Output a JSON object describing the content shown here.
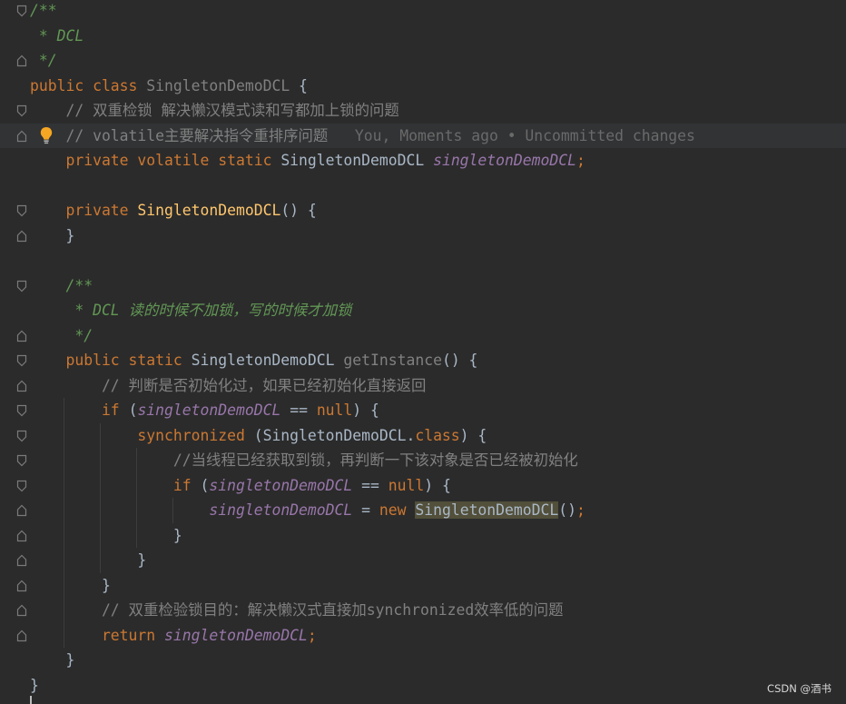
{
  "editor": {
    "blame_annotation": "You, Moments ago • Uncommitted changes",
    "lines": [
      [
        {
          "t": "/**",
          "c": "doc"
        }
      ],
      [
        {
          "t": " * DCL",
          "c": "doc"
        }
      ],
      [
        {
          "t": " */",
          "c": "doc"
        }
      ],
      [
        {
          "t": "public class ",
          "c": "kw"
        },
        {
          "t": "SingletonDemoDCL",
          "c": "mth-dim"
        },
        {
          "t": " {",
          "c": "cls"
        }
      ],
      [
        {
          "t": "    // 双重检锁 解决懒汉模式读和写都加上锁的问题",
          "c": "cmt"
        }
      ],
      [
        {
          "t": "    // volatile主要解决指令重排序问题",
          "c": "cmt"
        },
        {
          "t": "   You, Moments ago • Uncommitted changes",
          "c": "blame"
        }
      ],
      [
        {
          "t": "    private volatile static ",
          "c": "kw"
        },
        {
          "t": "SingletonDemoDCL ",
          "c": "cls"
        },
        {
          "t": "singletonDemoDCL",
          "c": "sfield"
        },
        {
          "t": ";",
          "c": "kw"
        }
      ],
      [],
      [
        {
          "t": "    private ",
          "c": "kw"
        },
        {
          "t": "SingletonDemoDCL",
          "c": "ctor"
        },
        {
          "t": "() {",
          "c": "cls"
        }
      ],
      [
        {
          "t": "    }",
          "c": "cls"
        }
      ],
      [],
      [
        {
          "t": "    /**",
          "c": "doc"
        }
      ],
      [
        {
          "t": "     * DCL 读的时候不加锁，写的时候才加锁",
          "c": "doc"
        }
      ],
      [
        {
          "t": "     */",
          "c": "doc"
        }
      ],
      [
        {
          "t": "    public static ",
          "c": "kw"
        },
        {
          "t": "SingletonDemoDCL ",
          "c": "cls"
        },
        {
          "t": "getInstance",
          "c": "mth-dim"
        },
        {
          "t": "() {",
          "c": "cls"
        }
      ],
      [
        {
          "t": "        // 判断是否初始化过，如果已经初始化直接返回",
          "c": "cmt"
        }
      ],
      [
        {
          "t": "        if ",
          "c": "kw"
        },
        {
          "t": "(",
          "c": "cls"
        },
        {
          "t": "singletonDemoDCL",
          "c": "sfield"
        },
        {
          "t": " == ",
          "c": "cls"
        },
        {
          "t": "null",
          "c": "kw"
        },
        {
          "t": ") {",
          "c": "cls"
        }
      ],
      [
        {
          "t": "            synchronized ",
          "c": "kw"
        },
        {
          "t": "(SingletonDemoDCL.",
          "c": "cls"
        },
        {
          "t": "class",
          "c": "kw"
        },
        {
          "t": ") {",
          "c": "cls"
        }
      ],
      [
        {
          "t": "                //当线程已经获取到锁，再判断一下该对象是否已经被初始化",
          "c": "cmt"
        }
      ],
      [
        {
          "t": "                if ",
          "c": "kw"
        },
        {
          "t": "(",
          "c": "cls"
        },
        {
          "t": "singletonDemoDCL",
          "c": "sfield"
        },
        {
          "t": " == ",
          "c": "cls"
        },
        {
          "t": "null",
          "c": "kw"
        },
        {
          "t": ") {",
          "c": "cls"
        }
      ],
      [
        {
          "t": "                    ",
          "c": "cls"
        },
        {
          "t": "singletonDemoDCL",
          "c": "sfield"
        },
        {
          "t": " = ",
          "c": "cls"
        },
        {
          "t": "new ",
          "c": "kw"
        },
        {
          "t": "SingletonDemoDCL",
          "c": "hl"
        },
        {
          "t": "()",
          "c": "cls"
        },
        {
          "t": ";",
          "c": "kw"
        }
      ],
      [
        {
          "t": "                }",
          "c": "cls"
        }
      ],
      [
        {
          "t": "            }",
          "c": "cls"
        }
      ],
      [
        {
          "t": "        }",
          "c": "cls"
        }
      ],
      [
        {
          "t": "        // 双重检验锁目的：解决懒汉式直接加synchronized效率低的问题",
          "c": "cmt"
        }
      ],
      [
        {
          "t": "        return ",
          "c": "kw"
        },
        {
          "t": "singletonDemoDCL",
          "c": "sfield"
        },
        {
          "t": ";",
          "c": "kw"
        }
      ],
      [
        {
          "t": "    }",
          "c": "cls"
        }
      ],
      [
        {
          "t": "}",
          "c": "cls"
        }
      ]
    ]
  },
  "watermark": "CSDN @酒书",
  "icons": {
    "fold_marker": "fold-marker-icon",
    "intention_bulb": "lightbulb-icon"
  },
  "colors": {
    "background": "#2b2b2b",
    "current_line": "#313335",
    "keyword": "#cc7832",
    "comment": "#808080",
    "doc_comment": "#629755",
    "static_field": "#9876aa",
    "method_decl": "#ffc66d",
    "text": "#a9b7c6",
    "highlight": "#524f3a",
    "bulb": "#f5a623"
  }
}
